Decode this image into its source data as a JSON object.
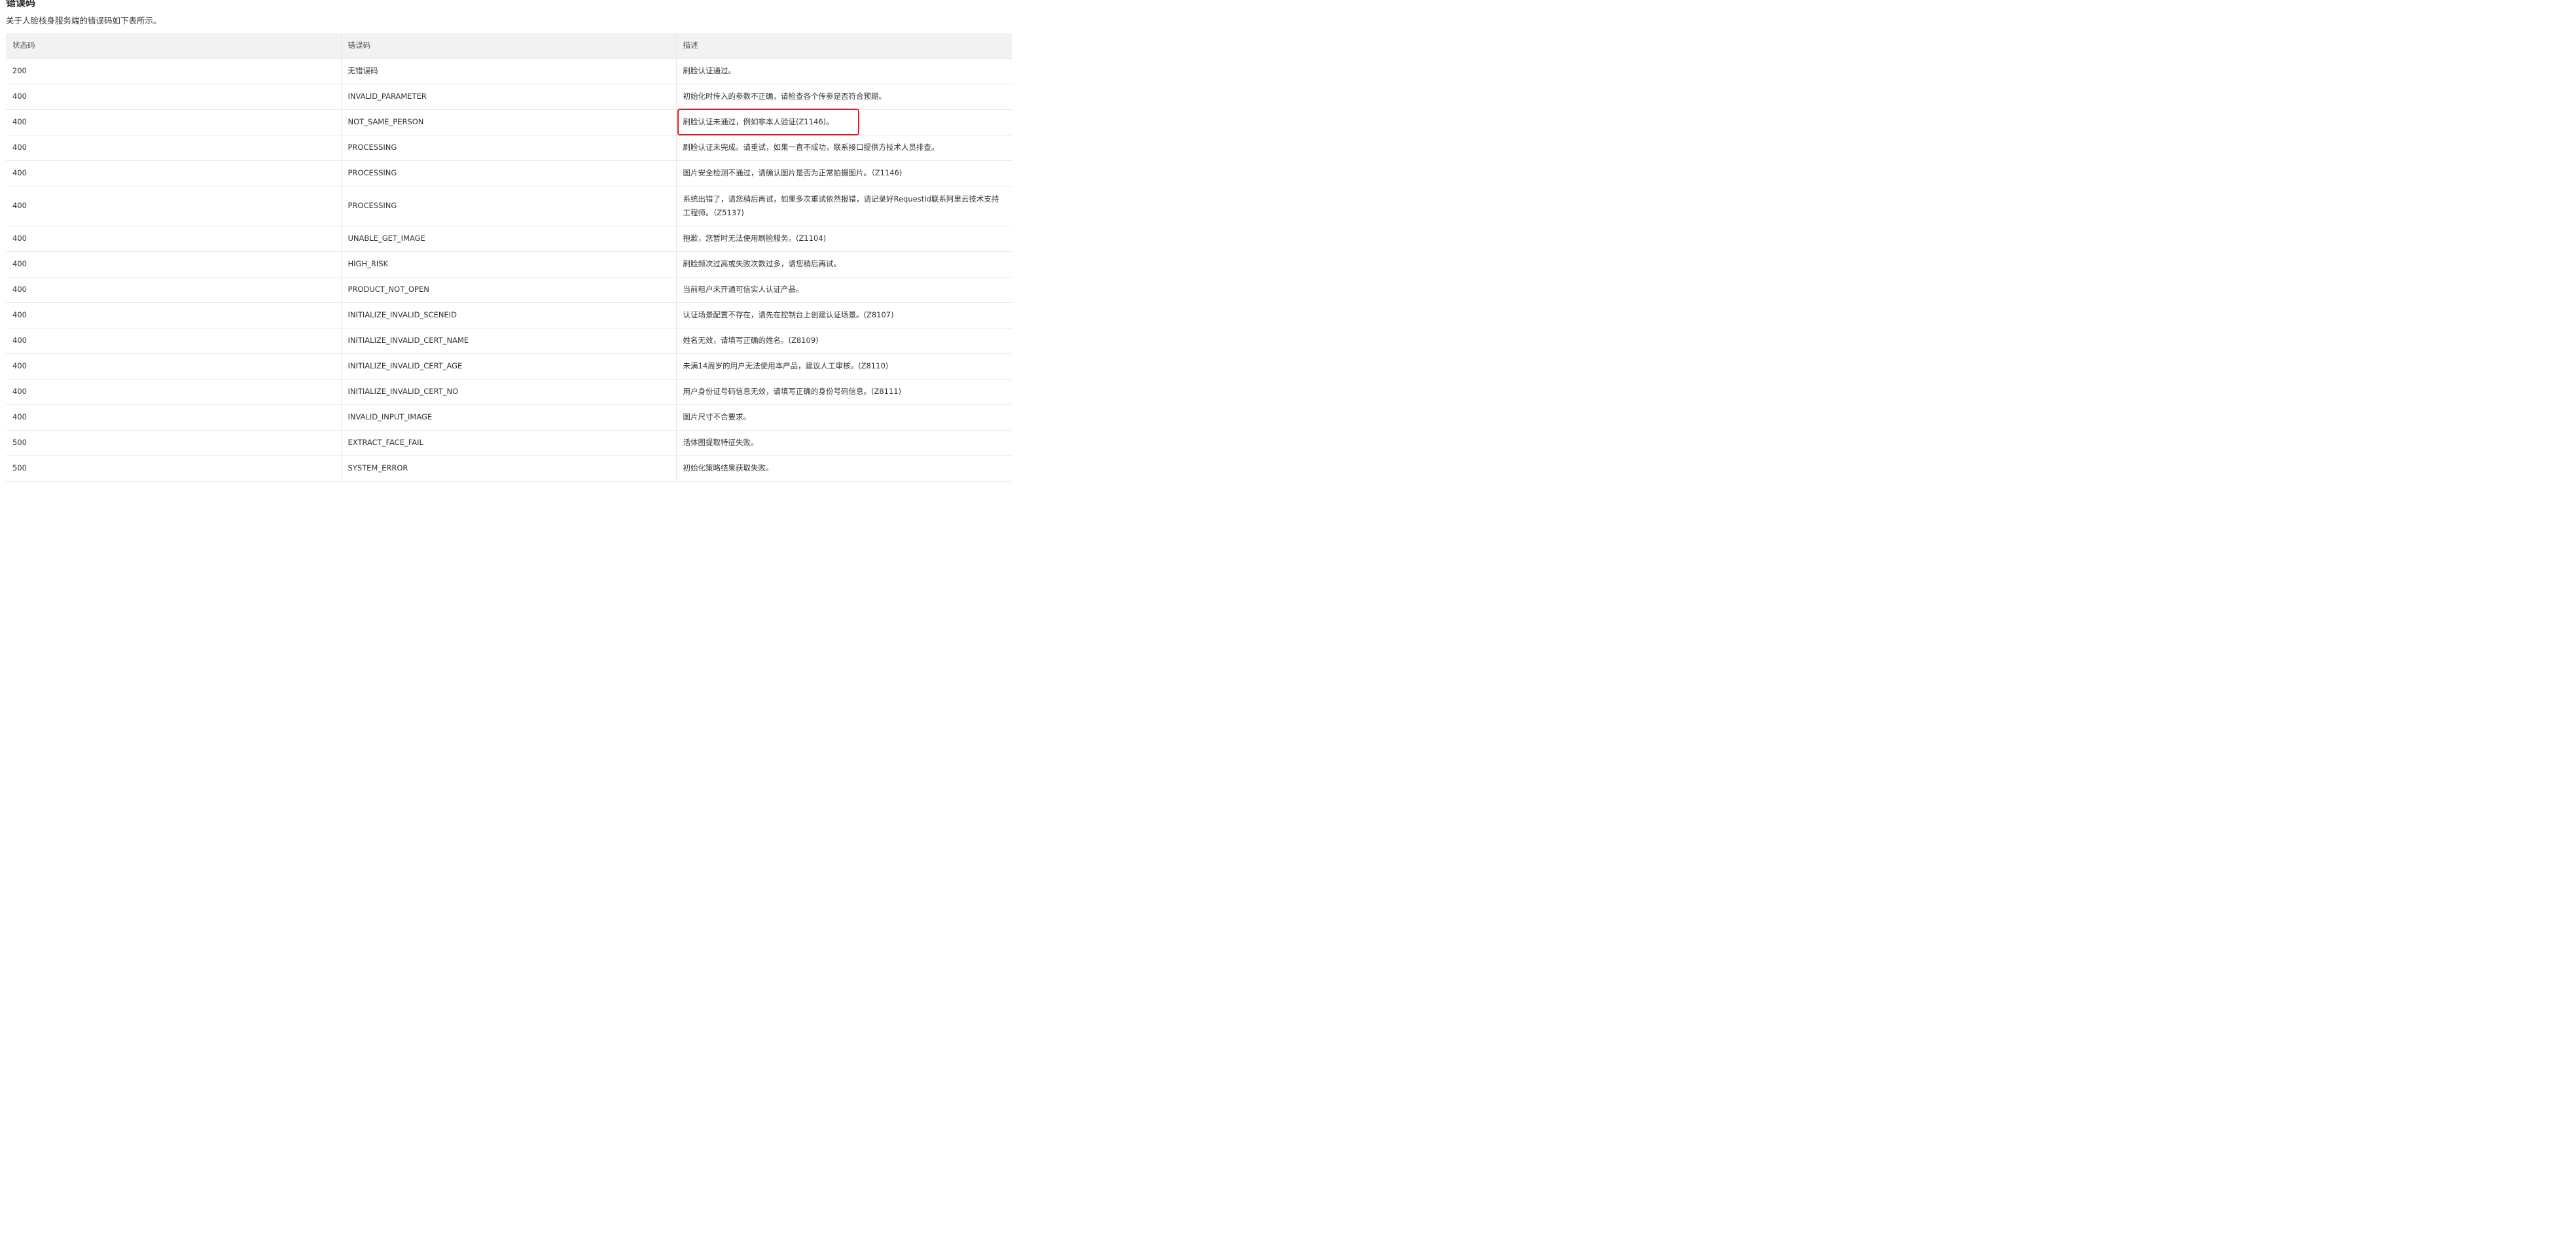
{
  "section": {
    "title": "错误码",
    "intro": "关于人脸核身服务端的错误码如下表所示。"
  },
  "table": {
    "headers": [
      "状态码",
      "错误码",
      "描述"
    ],
    "rows": [
      {
        "status": "200",
        "code": "无错误码",
        "desc": "刷脸认证通过。"
      },
      {
        "status": "400",
        "code": "INVALID_PARAMETER",
        "desc": "初始化时传入的参数不正确，请检查各个传参是否符合预期。"
      },
      {
        "status": "400",
        "code": "NOT_SAME_PERSON",
        "desc": "刷脸认证未通过，例如非本人验证(Z1146)。"
      },
      {
        "status": "400",
        "code": "PROCESSING",
        "desc": "刷脸认证未完成。请重试，如果一直不成功，联系接口提供方技术人员排查。"
      },
      {
        "status": "400",
        "code": "PROCESSING",
        "desc": "图片安全检测不通过，请确认图片是否为正常拍摄图片。（Z1146)"
      },
      {
        "status": "400",
        "code": "PROCESSING",
        "desc": "系统出错了，请您稍后再试，如果多次重试依然报错，请记录好RequestId联系阿里云技术支持工程师。（Z5137)"
      },
      {
        "status": "400",
        "code": "UNABLE_GET_IMAGE",
        "desc": "抱歉，您暂时无法使用刷脸服务。(Z1104)"
      },
      {
        "status": "400",
        "code": "HIGH_RISK",
        "desc": "刷脸频次过高或失败次数过多，请您稍后再试。"
      },
      {
        "status": "400",
        "code": "PRODUCT_NOT_OPEN",
        "desc": "当前租户未开通可信实人认证产品。"
      },
      {
        "status": "400",
        "code": "INITIALIZE_INVALID_SCENEID",
        "desc": "认证场景配置不存在，请先在控制台上创建认证场景。(Z8107)"
      },
      {
        "status": "400",
        "code": "INITIALIZE_INVALID_CERT_NAME",
        "desc": "姓名无效，请填写正确的姓名。(Z8109)"
      },
      {
        "status": "400",
        "code": "INITIALIZE_INVALID_CERT_AGE",
        "desc": "未满14周岁的用户无法使用本产品，建议人工审核。(Z8110)"
      },
      {
        "status": "400",
        "code": "INITIALIZE_INVALID_CERT_NO",
        "desc": "用户身份证号码信息无效，请填写正确的身份号码信息。(Z8111)"
      },
      {
        "status": "400",
        "code": "INVALID_INPUT_IMAGE",
        "desc": "图片尺寸不合要求。"
      },
      {
        "status": "500",
        "code": "EXTRACT_FACE_FAIL",
        "desc": "活体图提取特征失败。"
      },
      {
        "status": "500",
        "code": "SYSTEM_ERROR",
        "desc": "初始化策略结果获取失败。"
      }
    ]
  },
  "highlight": {
    "row": 3,
    "color": "#e02020"
  }
}
